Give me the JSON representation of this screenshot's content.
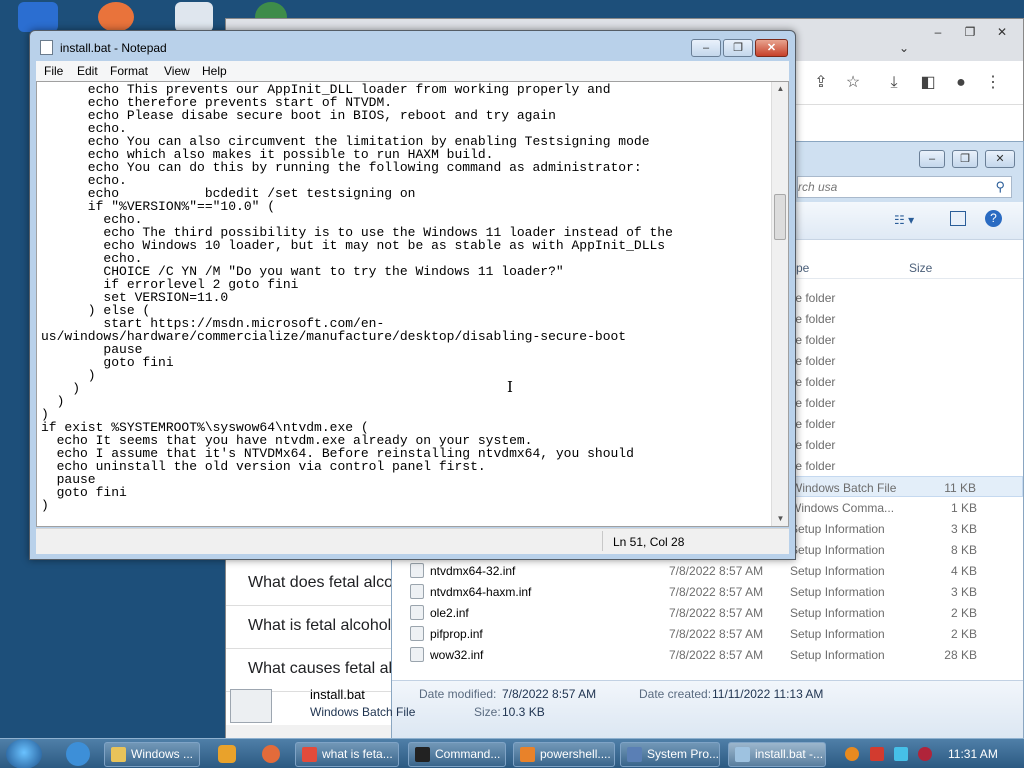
{
  "colors": {
    "titlebar": "#b9d1ea",
    "taskbar": "#2c5a82",
    "selection": "#e3eef9"
  },
  "chrome": {
    "controls": [
      "–",
      "❐",
      "✕"
    ],
    "icons": [
      "chevron-down-icon",
      "share-icon",
      "star-icon",
      "download-icon",
      "sidebar-icon",
      "profile-icon",
      "menu-icon"
    ],
    "page_questions": [
      "What does fetal alcohol s",
      "What is fetal alcohol sync",
      "What causes fetal alcoho"
    ]
  },
  "explorer": {
    "controls": [
      "–",
      "❐",
      "✕"
    ],
    "search_placeholder": "rch usa",
    "columns": {
      "type": "ype",
      "size": "Size"
    },
    "rows": [
      {
        "name": "",
        "date": "",
        "type": "ile folder",
        "size": ""
      },
      {
        "name": "",
        "date": "",
        "type": "ile folder",
        "size": ""
      },
      {
        "name": "",
        "date": "",
        "type": "ile folder",
        "size": ""
      },
      {
        "name": "",
        "date": "",
        "type": "ile folder",
        "size": ""
      },
      {
        "name": "",
        "date": "",
        "type": "ile folder",
        "size": ""
      },
      {
        "name": "",
        "date": "",
        "type": "ile folder",
        "size": ""
      },
      {
        "name": "",
        "date": "",
        "type": "ile folder",
        "size": ""
      },
      {
        "name": "",
        "date": "",
        "type": "ile folder",
        "size": ""
      },
      {
        "name": "",
        "date": "",
        "type": "ile folder",
        "size": ""
      },
      {
        "name": "",
        "date": "",
        "type": "Windows Batch File",
        "size": "11 KB"
      },
      {
        "name": "",
        "date": "",
        "type": "Windows Comma...",
        "size": "1 KB"
      },
      {
        "name": "",
        "date": "",
        "type": "Setup Information",
        "size": "3 KB"
      },
      {
        "name": "",
        "date": "",
        "type": "Setup Information",
        "size": "8 KB"
      },
      {
        "name": "ntvdmx64-32.inf",
        "date": "7/8/2022 8:57 AM",
        "type": "Setup Information",
        "size": "4 KB"
      },
      {
        "name": "ntvdmx64-haxm.inf",
        "date": "7/8/2022 8:57 AM",
        "type": "Setup Information",
        "size": "3 KB"
      },
      {
        "name": "ole2.inf",
        "date": "7/8/2022 8:57 AM",
        "type": "Setup Information",
        "size": "2 KB"
      },
      {
        "name": "pifprop.inf",
        "date": "7/8/2022 8:57 AM",
        "type": "Setup Information",
        "size": "2 KB"
      },
      {
        "name": "wow32.inf",
        "date": "7/8/2022 8:57 AM",
        "type": "Setup Information",
        "size": "28 KB"
      }
    ],
    "details": {
      "filename": "install.bat",
      "filetype": "Windows Batch File",
      "modified_label": "Date modified:",
      "modified": "7/8/2022 8:57 AM",
      "created_label": "Date created:",
      "created": "11/11/2022 11:13 AM",
      "size_label": "Size:",
      "size": "10.3 KB"
    }
  },
  "notepad": {
    "title": "install.bat - Notepad",
    "controls": {
      "minimize": "–",
      "maximize": "❐",
      "close": "✕"
    },
    "menu": [
      "File",
      "Edit",
      "Format",
      "View",
      "Help"
    ],
    "content": "      echo This prevents our AppInit_DLL loader from working properly and\n      echo therefore prevents start of NTVDM.\n      echo Please disabe secure boot in BIOS, reboot and try again\n      echo.\n      echo You can also circumvent the limitation by enabling Testsigning mode\n      echo which also makes it possible to run HAXM build.\n      echo You can do this by running the following command as administrator:\n      echo.\n      echo           bcdedit /set testsigning on\n      if \"%VERSION%\"==\"10.0\" (\n        echo.\n        echo The third possibility is to use the Windows 11 loader instead of the\n        echo Windows 10 loader, but it may not be as stable as with AppInit_DLLs\n        echo.\n        CHOICE /C YN /M \"Do you want to try the Windows 11 loader?\"\n        if errorlevel 2 goto fini\n        set VERSION=11.0\n      ) else (\n        start https://msdn.microsoft.com/en-\nus/windows/hardware/commercialize/manufacture/desktop/disabling-secure-boot\n        pause\n        goto fini\n      )\n    )\n  )\n)\nif exist %SYSTEMROOT%\\syswow64\\ntvdm.exe (\n  echo It seems that you have ntvdm.exe already on your system.\n  echo I assume that it's NTVDMx64. Before reinstalling ntvdmx64, you should\n  echo uninstall the old version via control panel first.\n  pause\n  goto fini\n)",
    "status_position": "Ln 51, Col 28"
  },
  "taskbar": {
    "tasks": [
      {
        "label": "Windows ...",
        "color": "#e8c35a",
        "active": false
      },
      {
        "label": "what is feta...",
        "color": "#e34b3b",
        "active": false
      },
      {
        "label": "Command...",
        "color": "#222222",
        "active": false
      },
      {
        "label": "powershell....",
        "color": "#e8822a",
        "active": false
      },
      {
        "label": "System Pro...",
        "color": "#5a7fb5",
        "active": false
      },
      {
        "label": "install.bat -...",
        "color": "#9ec2e0",
        "active": true
      }
    ],
    "clock": "11:31 AM"
  }
}
